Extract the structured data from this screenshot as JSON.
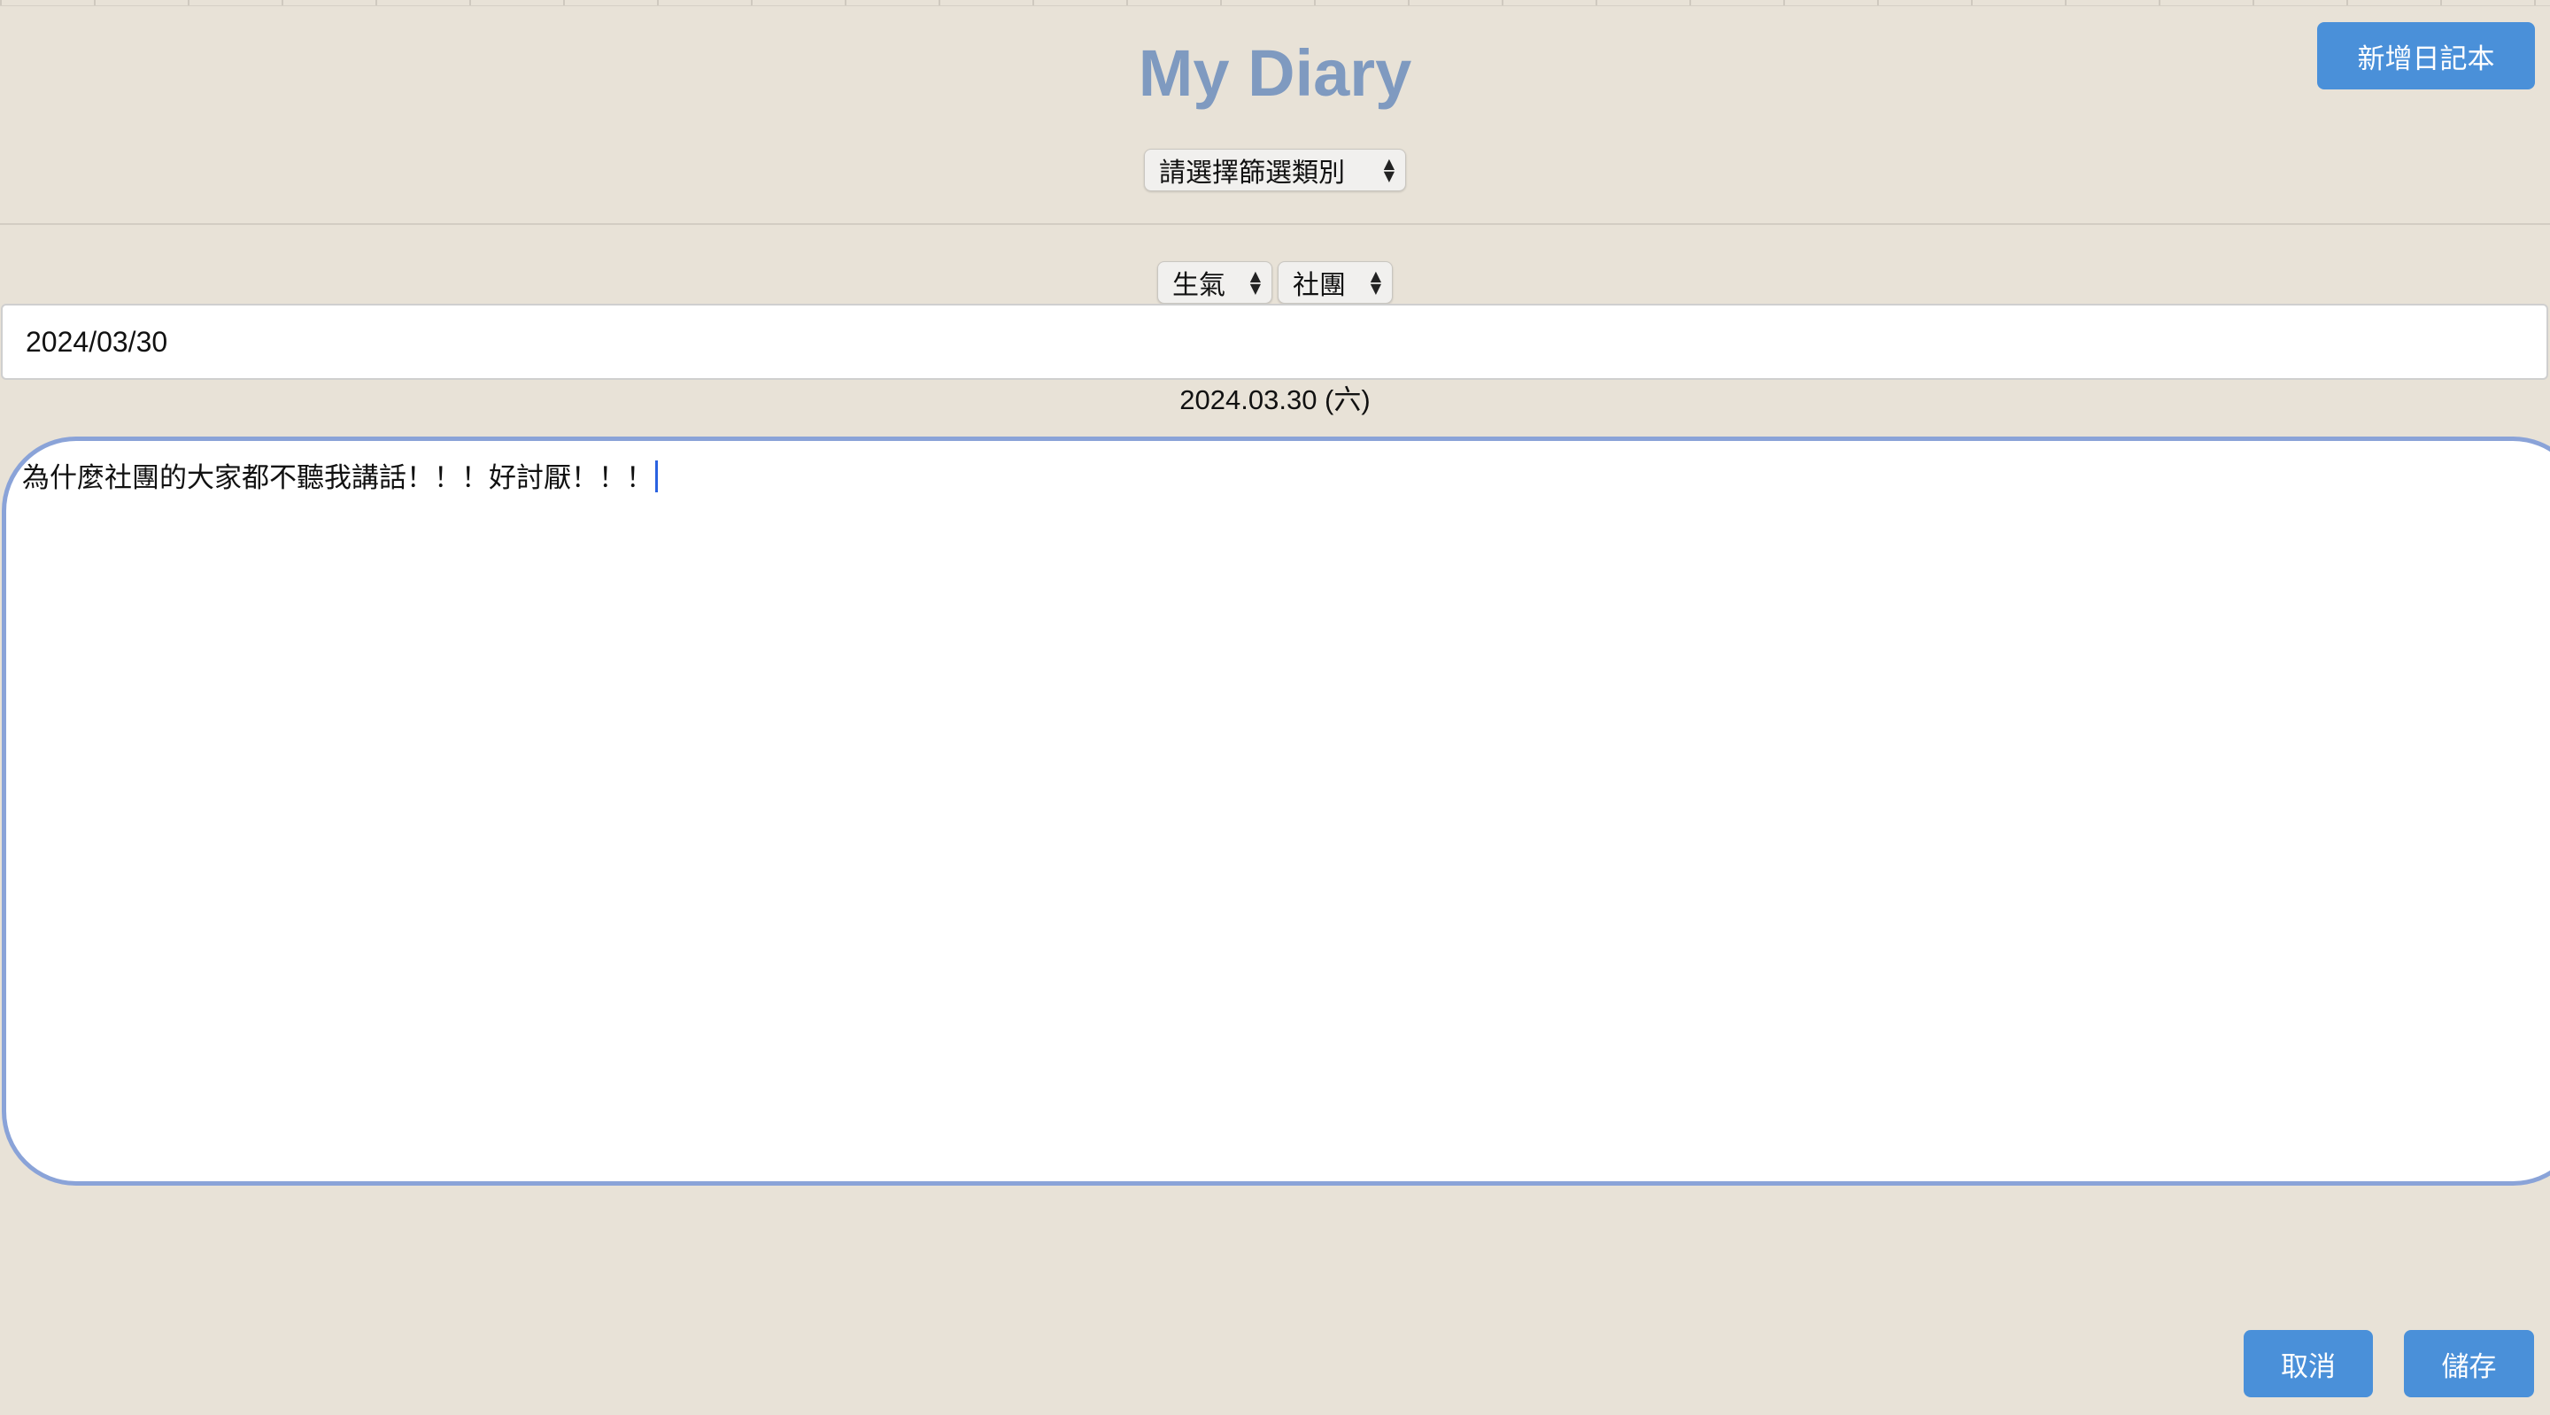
{
  "app": {
    "title": "My Diary",
    "new_diary_label": "新增日記本"
  },
  "filter": {
    "selected": "請選擇篩選類別"
  },
  "entry": {
    "mood_selected": "生氣",
    "category_selected": "社團",
    "date_value": "2024/03/30",
    "date_display": "2024.03.30 (六)",
    "content": "為什麼社團的大家都不聽我講話！！！好討厭！！！"
  },
  "actions": {
    "cancel_label": "取消",
    "save_label": "儲存"
  },
  "colors": {
    "background": "#e8e2d7",
    "title": "#7f9ac0",
    "button": "#4a90d9",
    "textarea_border": "#8aa3d8"
  }
}
